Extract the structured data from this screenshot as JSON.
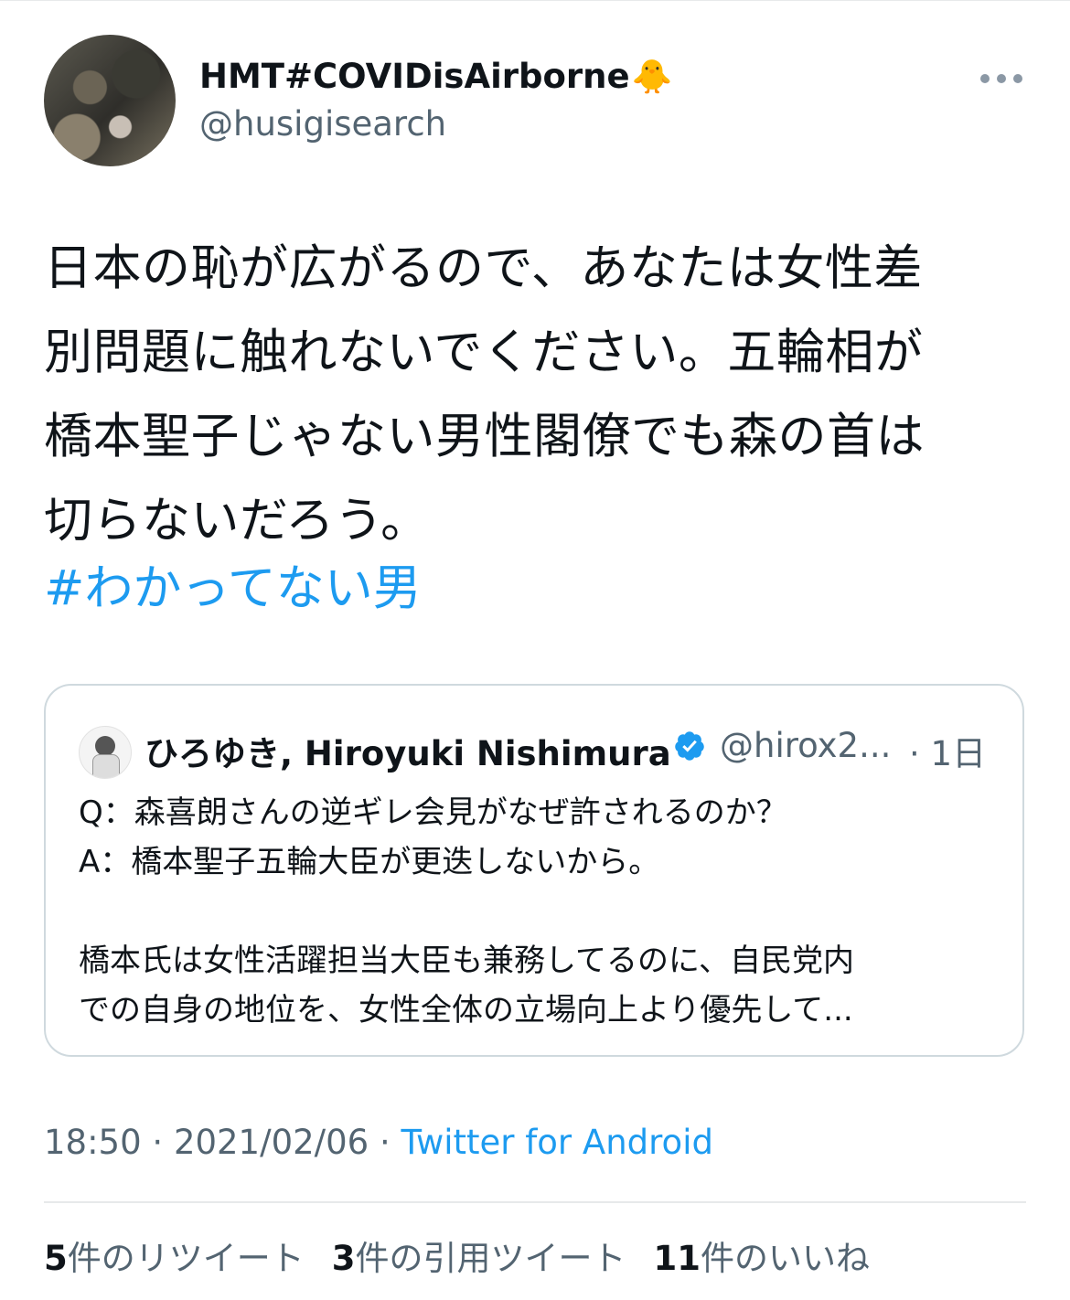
{
  "author": {
    "display_name": "HMT#COVIDisAirborne",
    "emoji": "🐥",
    "handle": "@husigisearch"
  },
  "tweet": {
    "lines": [
      "日本の恥が広がるので、あなたは女性差",
      "別問題に触れないでください。五輪相が",
      "橋本聖子じゃない男性閣僚でも森の首は",
      "切らないだろう。"
    ],
    "hashtag": "#わかってない男"
  },
  "quote": {
    "name": "ひろゆき, Hiroyuki Nishimura",
    "handle": "@hirox2...",
    "time": "· 1日",
    "lines": [
      "Q：森喜朗さんの逆ギレ会見がなぜ許されるのか？",
      "A：橋本聖子五輪大臣が更迭しないから。",
      "橋本氏は女性活躍担当大臣も兼務してるのに、自民党内",
      "での自身の地位を、女性全体の立場向上より優先して..."
    ]
  },
  "meta": {
    "time": "18:50",
    "sep1": " · ",
    "date": "2021/02/06",
    "sep2": " · ",
    "source": "Twitter for Android"
  },
  "stats": {
    "retweets_count": "5",
    "retweets_label": "件のリツイート",
    "quotes_count": "3",
    "quotes_label": "件の引用ツイート",
    "likes_count": "11",
    "likes_label": "件のいいね"
  },
  "colors": {
    "link": "#1d9bf0",
    "secondary": "#536471",
    "verified": "#1d9bf0"
  }
}
